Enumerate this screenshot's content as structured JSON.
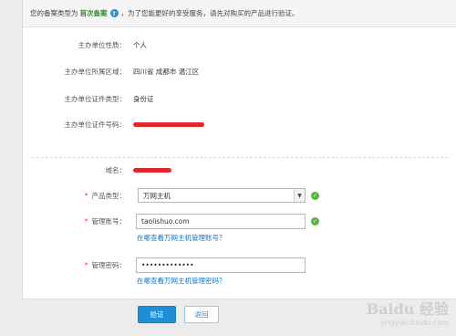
{
  "notice": {
    "prefix": "您的备案类型为",
    "type": "首次备案",
    "help_glyph": "?",
    "suffix": "，为了您能更好的享受服务，请先对购买的产品进行验证。"
  },
  "info": {
    "nature_label": "主办单位性质：",
    "nature_value": "个人",
    "region_label": "主办单位所属区域：",
    "region_value": "四川省 成都市 温江区",
    "cert_type_label": "主办单位证件类型：",
    "cert_type_value": "身份证",
    "cert_no_label": "主办单位证件号码："
  },
  "form": {
    "domain_label": "域名：",
    "star": "*",
    "product_label": "产品类型：",
    "product_value": "万网主机",
    "account_label": "管理账号：",
    "account_value": "taolishuo.com",
    "account_help": "在哪查看万网主机管理账号？",
    "password_label": "管理密码：",
    "password_value": "•••••••••••••",
    "password_help": "在哪查看万网主机管理密码？",
    "ok_glyph": "✓",
    "arrow_glyph": "▼"
  },
  "buttons": {
    "verify": "验证",
    "back": "返回"
  },
  "watermark": {
    "brand": "Baidu 经验",
    "url": "jingyan.baidu.com"
  },
  "colors": {
    "accent": "#1e8fd6",
    "success": "#53b83a",
    "required": "#e4393c",
    "redaction": "#e0282c"
  }
}
